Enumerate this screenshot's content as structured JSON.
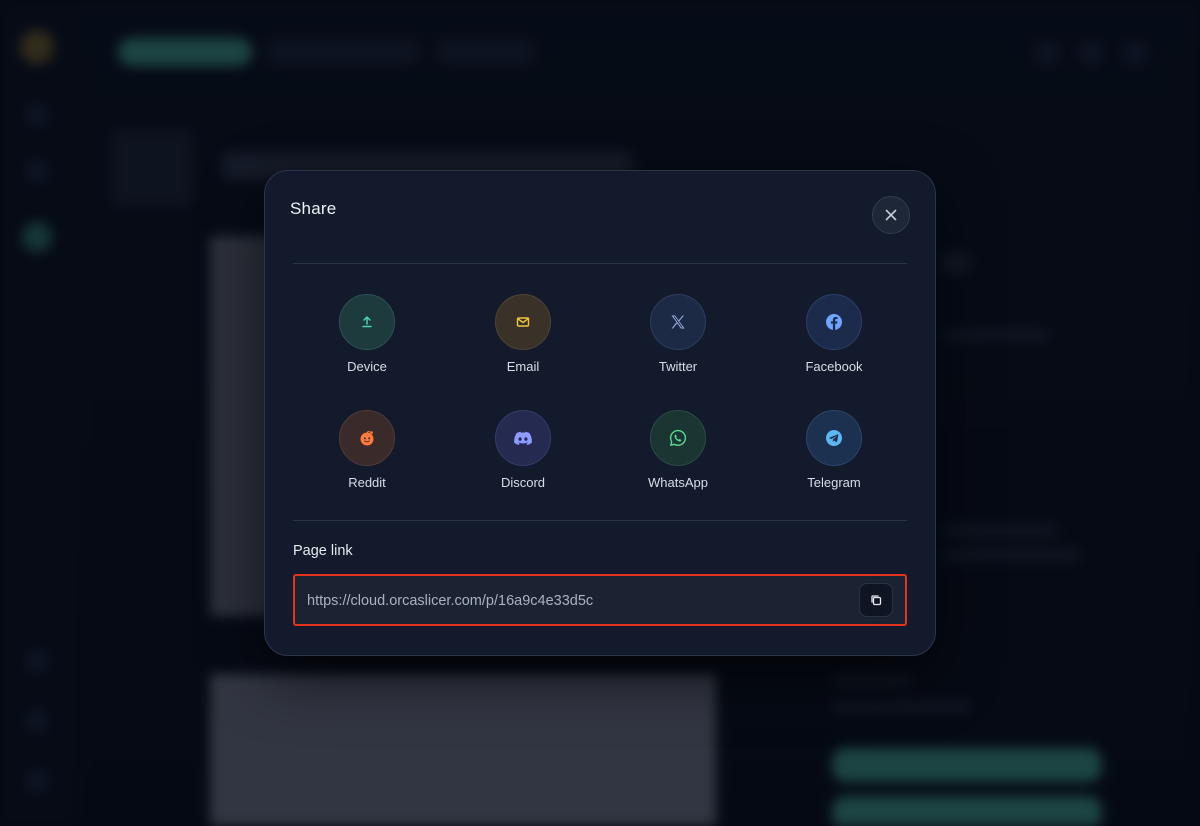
{
  "modal": {
    "title": "Share",
    "page_link_label": "Page link",
    "page_link_url": "https://cloud.orcaslicer.com/p/16a9c4e33d5c"
  },
  "share_options": [
    {
      "label": "Device",
      "icon": "upload-icon",
      "bg": "#1d3a3c",
      "border": "#2c5356",
      "color": "#4fd1b8"
    },
    {
      "label": "Email",
      "icon": "mail-icon",
      "bg": "#3a3228",
      "border": "#4e4433",
      "color": "#f0c53e"
    },
    {
      "label": "Twitter",
      "icon": "x-logo-icon",
      "bg": "#1d2a45",
      "border": "#2d3d5e",
      "color": "#9fb7e6"
    },
    {
      "label": "Facebook",
      "icon": "facebook-icon",
      "bg": "#1c2b4c",
      "border": "#2b3e66",
      "color": "#6ea5ff"
    },
    {
      "label": "Reddit",
      "icon": "reddit-icon",
      "bg": "#3b2a2a",
      "border": "#523938",
      "color": "#ff7a3c"
    },
    {
      "label": "Discord",
      "icon": "discord-icon",
      "bg": "#252a50",
      "border": "#363c6a",
      "color": "#8e9bff"
    },
    {
      "label": "WhatsApp",
      "icon": "whatsapp-icon",
      "bg": "#1b3632",
      "border": "#294c46",
      "color": "#57d98f"
    },
    {
      "label": "Telegram",
      "icon": "telegram-icon",
      "bg": "#1c3150",
      "border": "#2b4568",
      "color": "#5cb8f5"
    }
  ],
  "colors": {
    "highlight_border": "#e5321f",
    "modal_bg": "#121a2b"
  }
}
